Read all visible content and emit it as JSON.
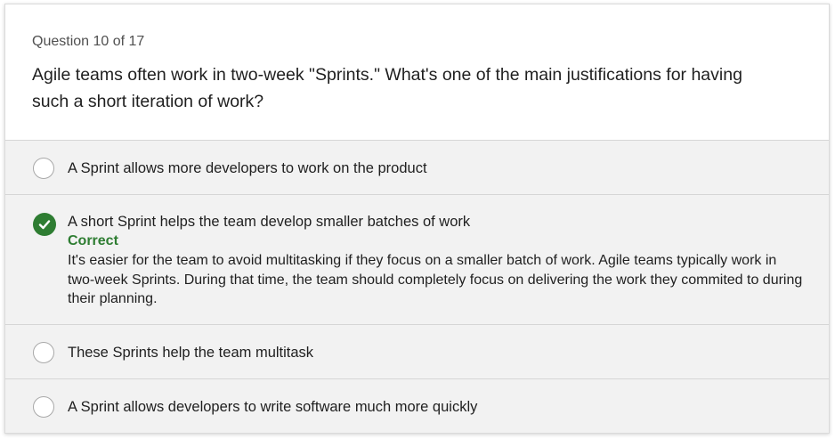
{
  "question": {
    "counter": "Question 10 of 17",
    "text": "Agile teams often work in two-week \"Sprints.\" What's one of the main justifications for having such a short iteration of work?"
  },
  "options": [
    {
      "label": "A Sprint allows more developers to work on the product",
      "selected": false
    },
    {
      "label": "A short Sprint helps the team develop smaller batches of work",
      "selected": true,
      "status": "Correct",
      "explanation": "It's easier for the team to avoid multitasking if they focus on a smaller batch of work. Agile teams typically work in two-week Sprints. During that time, the team should completely focus on delivering the work they commited to during their planning."
    },
    {
      "label": "These Sprints help the team multitask",
      "selected": false
    },
    {
      "label": "A Sprint allows developers to write software much more quickly",
      "selected": false
    }
  ],
  "colors": {
    "correct": "#2e7d32",
    "option_bg": "#f2f2f2"
  }
}
